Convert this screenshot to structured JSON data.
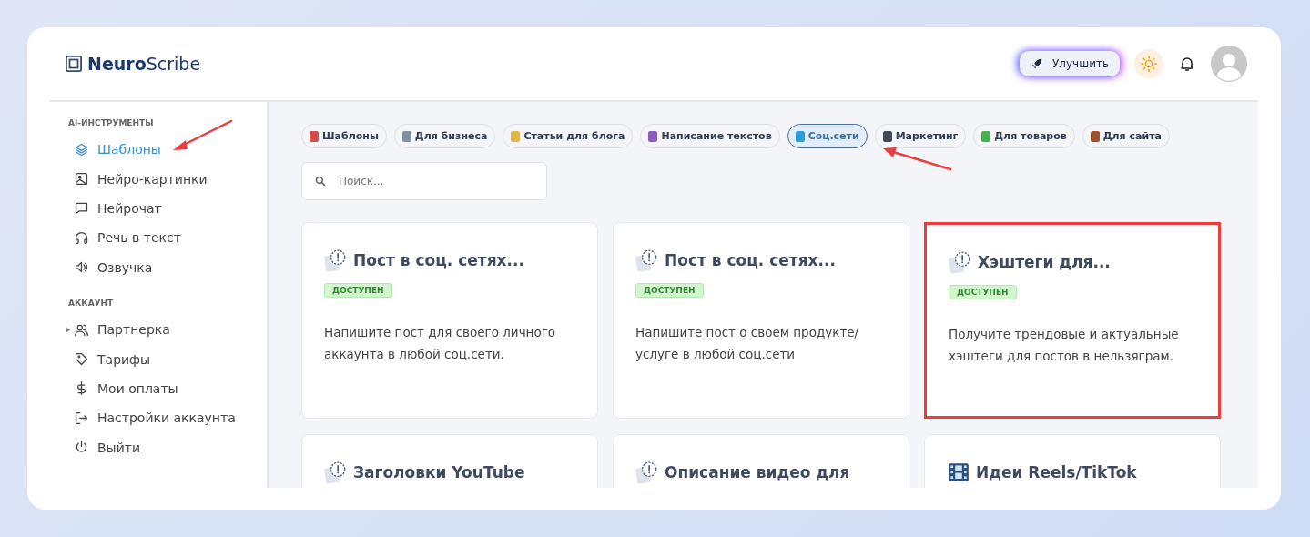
{
  "logo": {
    "bold": "Neuro",
    "light": "Scribe"
  },
  "header": {
    "upgrade_button": "Улучшить"
  },
  "sidebar": {
    "sections": [
      {
        "title": "AI-ИНСТРУМЕНТЫ",
        "items": [
          {
            "label": "Шаблоны",
            "kind": "layers",
            "selected": true,
            "expandable": false
          },
          {
            "label": "Нейро-картинки",
            "kind": "image",
            "selected": false,
            "expandable": false
          },
          {
            "label": "Нейрочат",
            "kind": "chat",
            "selected": false,
            "expandable": false
          },
          {
            "label": "Речь в текст",
            "kind": "headphones",
            "selected": false,
            "expandable": false
          },
          {
            "label": "Озвучка",
            "kind": "speaker",
            "selected": false,
            "expandable": false
          }
        ]
      },
      {
        "title": "АККАУНТ",
        "items": [
          {
            "label": "Партнерка",
            "kind": "users",
            "selected": false,
            "expandable": true
          },
          {
            "label": "Тарифы",
            "kind": "tag",
            "selected": false,
            "expandable": false
          },
          {
            "label": "Мои оплаты",
            "kind": "dollar",
            "selected": false,
            "expandable": false
          },
          {
            "label": "Настройки аккаунта",
            "kind": "logout",
            "selected": false,
            "expandable": false
          },
          {
            "label": "Выйти",
            "kind": "power",
            "selected": false,
            "expandable": false
          }
        ]
      }
    ]
  },
  "categories": [
    {
      "label": "Шаблоны",
      "color": "#d94a4a",
      "selected": false
    },
    {
      "label": "Для бизнеса",
      "color": "#7f8fa6",
      "selected": false
    },
    {
      "label": "Статьи для блога",
      "color": "#e0b84a",
      "selected": false
    },
    {
      "label": "Написание текстов",
      "color": "#8e5cc4",
      "selected": false
    },
    {
      "label": "Соц.сети",
      "color": "#2a9fd6",
      "selected": true
    },
    {
      "label": "Маркетинг",
      "color": "#444a55",
      "selected": false
    },
    {
      "label": "Для товаров",
      "color": "#4caf50",
      "selected": false
    },
    {
      "label": "Для сайта",
      "color": "#a0522d",
      "selected": false
    }
  ],
  "search": {
    "placeholder": "Поиск..."
  },
  "cards": [
    {
      "title": "Пост в соц. сетях...",
      "kind": "alert",
      "badge": "ДОСТУПЕН",
      "description": "Напишите пост для своего личного аккаунта в любой соц.сети.",
      "highlighted": false
    },
    {
      "title": "Пост в соц. сетях...",
      "kind": "alert",
      "badge": "ДОСТУПЕН",
      "description": "Напишите пост о своем продукте/ услуге в любой соц.сети",
      "highlighted": false
    },
    {
      "title": "Хэштеги для...",
      "kind": "alert",
      "badge": "ДОСТУПЕН",
      "description": "Получите трендовые и актуальные хэштеги для постов в нельзяграм.",
      "highlighted": true
    },
    {
      "title": "Заголовки YouTube",
      "kind": "alert",
      "highlighted": false
    },
    {
      "title": "Описание видео для",
      "kind": "alert",
      "highlighted": false
    },
    {
      "title": "Идеи Reels/TikTok",
      "kind": "film",
      "highlighted": false
    }
  ]
}
